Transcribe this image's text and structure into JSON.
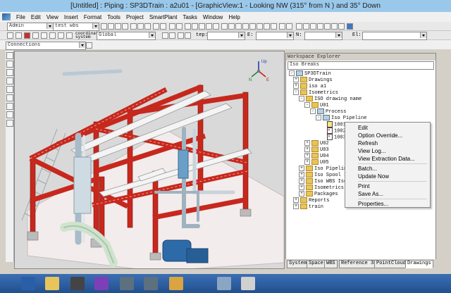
{
  "window": {
    "title": "[Untitled] : Piping : SP3DTrain : a2u01 - [GraphicView:1 - Looking NW (315° from N ) and 35° Down"
  },
  "menubar": {
    "items": [
      "File",
      "Edit",
      "View",
      "Insert",
      "Format",
      "Tools",
      "Project",
      "SmartPlant",
      "Tasks",
      "Window",
      "Help"
    ]
  },
  "toolbar1": {
    "permission_group": "Admin",
    "workspace": "test wbs"
  },
  "toolbar2": {
    "coordinate_system_label": "coordinate system",
    "coordinate_system": "Global",
    "step_label": "tep:",
    "e_label": "E:",
    "n_label": "N:",
    "el_label": "El:"
  },
  "toolbar3": {
    "filter": "Connections"
  },
  "viewport": {
    "axis_labels": {
      "up": "Up",
      "n": "N",
      "e": "E"
    }
  },
  "explorer": {
    "title": "Workspace Explorer",
    "filter": "Iso Breaks",
    "tree": [
      {
        "label": "SP3DTrain",
        "indent": 0,
        "icon": "root-icon"
      },
      {
        "label": "Drawings",
        "indent": 1,
        "icon": "folder-icon"
      },
      {
        "label": "iso a1",
        "indent": 1,
        "icon": "folder-icon"
      },
      {
        "label": "Isometrics",
        "indent": 1,
        "icon": "folder-icon"
      },
      {
        "label": "ISO drawing name",
        "indent": 2,
        "icon": "folder-icon"
      },
      {
        "label": "U01",
        "indent": 3,
        "icon": "folder-icon"
      },
      {
        "label": "Process",
        "indent": 4,
        "icon": "system-icon"
      },
      {
        "label": "Iso Pipeline",
        "indent": 5,
        "icon": "pipeline-icon"
      },
      {
        "label": "1001-P",
        "indent": 6,
        "icon": "drawing-icon"
      },
      {
        "label": "1002",
        "indent": 6,
        "icon": "drawing-error-icon"
      },
      {
        "label": "1003",
        "indent": 6,
        "icon": "drawing-error-icon"
      },
      {
        "label": "U02",
        "indent": 3,
        "icon": "folder-icon"
      },
      {
        "label": "U03",
        "indent": 3,
        "icon": "folder-icon"
      },
      {
        "label": "U04",
        "indent": 3,
        "icon": "folder-icon"
      },
      {
        "label": "U05",
        "indent": 3,
        "icon": "folder-icon"
      },
      {
        "label": "Iso Pipeline I",
        "indent": 2,
        "icon": "folder-icon"
      },
      {
        "label": "Iso Spool Isom",
        "indent": 2,
        "icon": "folder-icon"
      },
      {
        "label": "Iso WBS Isomet",
        "indent": 2,
        "icon": "folder-icon"
      },
      {
        "label": "Isometrics wit",
        "indent": 2,
        "icon": "folder-icon"
      },
      {
        "label": "Packages",
        "indent": 2,
        "icon": "folder-icon"
      },
      {
        "label": "Reports",
        "indent": 1,
        "icon": "folder-icon"
      },
      {
        "label": "train",
        "indent": 1,
        "icon": "folder-icon"
      }
    ],
    "tabs": [
      "System",
      "Space",
      "WBS",
      "Reference 3D",
      "PointCloud",
      "Drawings"
    ],
    "active_tab": "Drawings"
  },
  "context_menu": {
    "items": [
      "Edit",
      "Option Override...",
      "Refresh",
      "View Log...",
      "View Extraction Data...",
      "Batch...",
      "Update Now",
      "Print",
      "Save As...",
      "Properties..."
    ]
  },
  "taskbar": {
    "icons": [
      "powershell-icon",
      "file-explorer-icon",
      "server-manager-icon",
      "visual-studio-icon",
      "smartplant-icon",
      "smartplant-icon-2",
      "file-icon",
      "network-tool-icon",
      "app-icon"
    ]
  }
}
